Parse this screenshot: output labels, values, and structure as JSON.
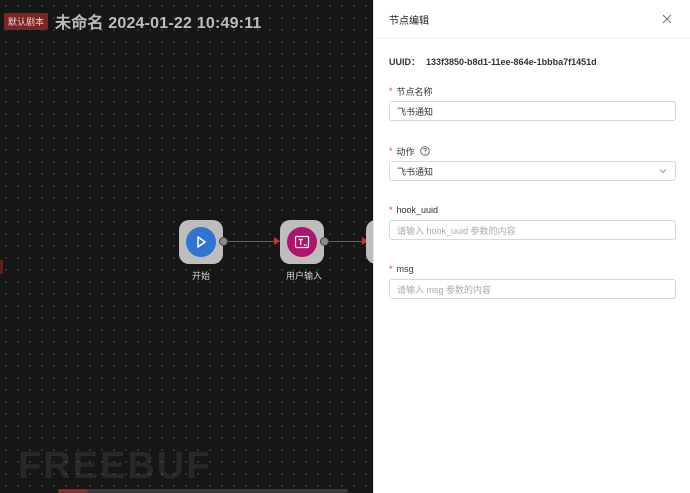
{
  "canvas": {
    "badge": "默认剧本",
    "title": "未命名 2024-01-22 10:49:11",
    "nodes": [
      {
        "label": "开始",
        "icon": "play-icon",
        "color": "#2f74d0"
      },
      {
        "label": "用户输入",
        "icon": "text-input-icon",
        "color": "#b0136b"
      }
    ],
    "watermark": "FREEBUF"
  },
  "panel": {
    "title": "节点编辑",
    "uuid_label": "UUID：",
    "uuid_value": "133f3850-b8d1-11ee-864e-1bbba7f1451d",
    "fields": {
      "name": {
        "label": "节点名称",
        "value": "飞书通知"
      },
      "action": {
        "label": "动作",
        "value": "飞书通知"
      },
      "hook_uuid": {
        "label": "hook_uuid",
        "placeholder": "请输入 hook_uuid 参数的内容"
      },
      "msg": {
        "label": "msg",
        "placeholder": "请输入 msg 参数的内容"
      }
    }
  },
  "colors": {
    "accent_red": "#c0392b",
    "required": "#e53935"
  }
}
